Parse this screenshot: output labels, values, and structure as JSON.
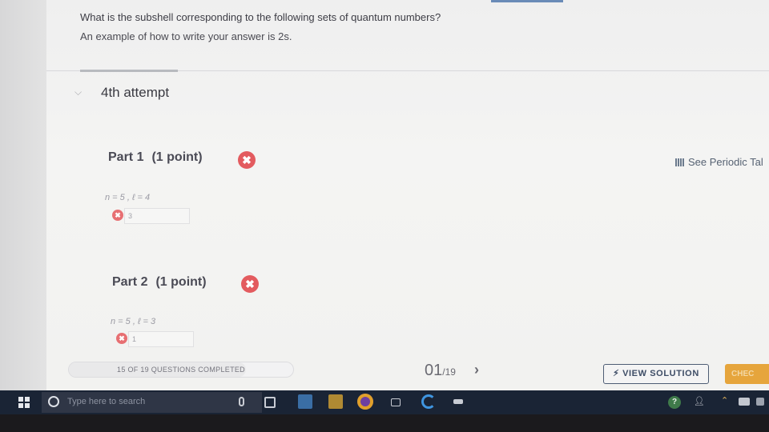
{
  "question": {
    "line1": "What is the subshell corresponding to the following sets of quantum numbers?",
    "line2": "An example of how to write your answer is 2s."
  },
  "attempt": {
    "title": "4th attempt"
  },
  "parts": [
    {
      "label": "Part 1",
      "points": "(1 point)",
      "quantum_numbers": "n = 5 , ℓ = 4",
      "answer": "3"
    },
    {
      "label": "Part 2",
      "points": "(1 point)",
      "quantum_numbers": "n = 5 , ℓ = 3",
      "answer": "1"
    }
  ],
  "periodic_table_link": "See Periodic Tal",
  "progress": {
    "text": "15 OF 19 QUESTIONS COMPLETED",
    "completed": 15,
    "total": 19
  },
  "question_counter": {
    "current": "01",
    "total": "/19"
  },
  "buttons": {
    "view_solution": "VIEW SOLUTION",
    "check": "CHEC"
  },
  "taskbar": {
    "search_placeholder": "Type here to search"
  },
  "icons": {
    "wrong": "close-icon",
    "chevron": "chevron-down-icon",
    "next": "chevron-right-icon",
    "periodic": "table-icon",
    "bolt": "lightning-icon"
  },
  "colors": {
    "wrong_red": "#e35b5f",
    "check_orange": "#e6a53c",
    "solution_border": "#4e5d74",
    "taskbar": "#1a2435"
  }
}
